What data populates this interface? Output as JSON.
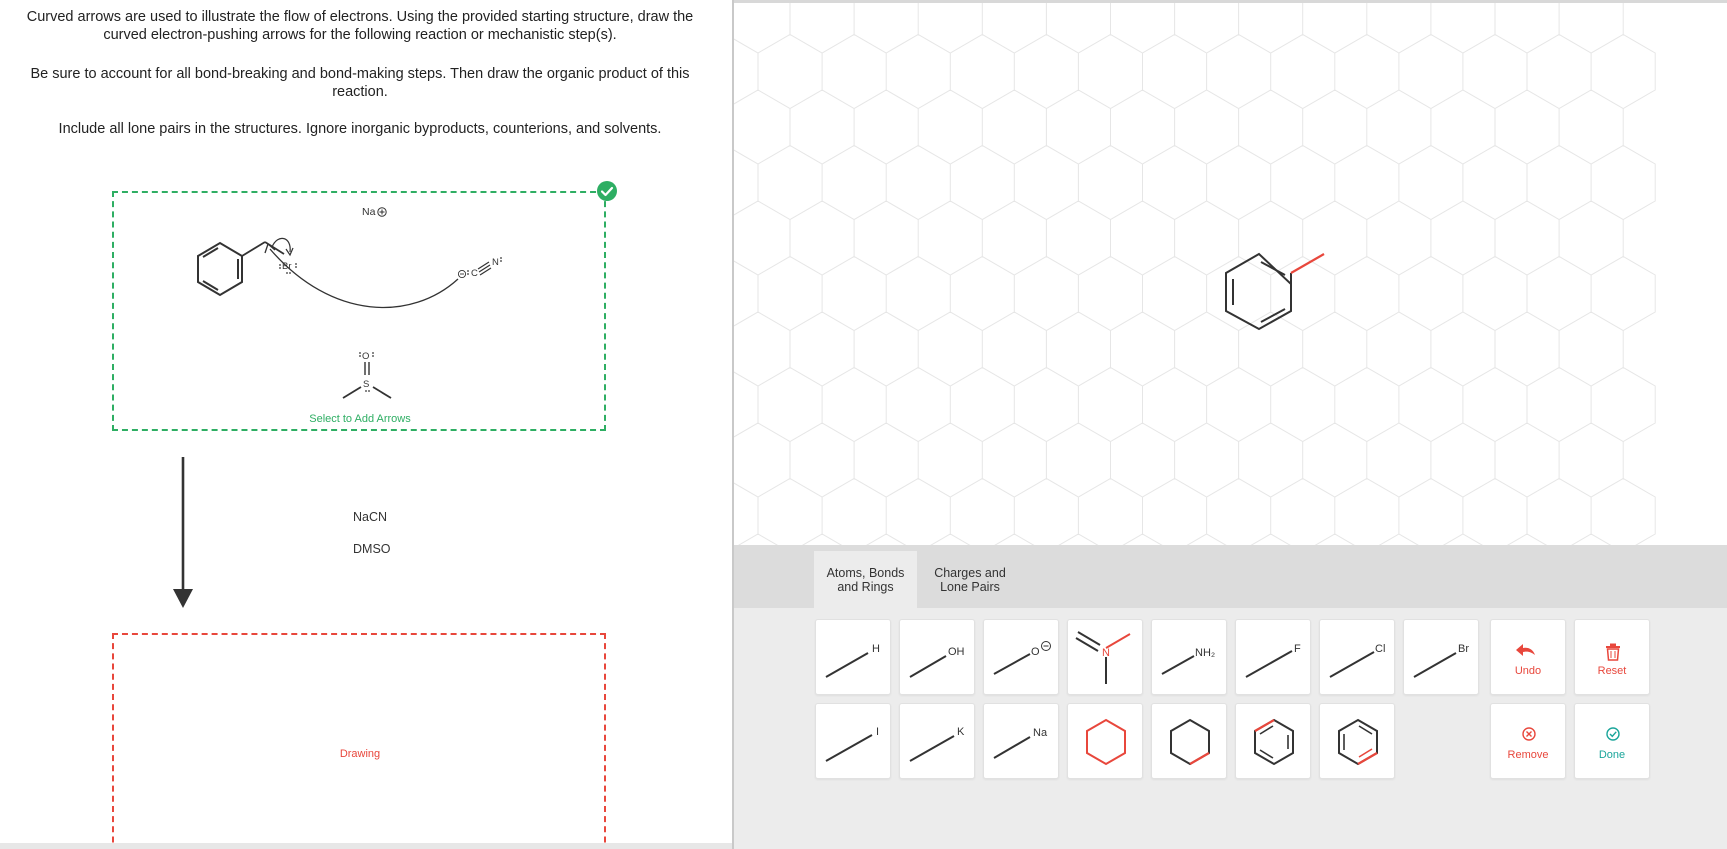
{
  "instructions": {
    "line1": "Curved arrows are used to illustrate the flow of electrons. Using the provided starting structure, draw the curved electron-pushing arrows for the following reaction or mechanistic step(s).",
    "line2": "Be sure to account for all bond-breaking and bond-making steps. Then draw the organic product of this reaction.",
    "line3": "Include all lone pairs in the structures. Ignore inorganic byproducts, counterions, and solvents."
  },
  "starting_structure": {
    "select_label": "Select to Add Arrows",
    "counterion": "Na",
    "bromine_label": "Br",
    "cyanide_c": "C",
    "cyanide_n": "N",
    "dmso_o": "O",
    "dmso_s": "S"
  },
  "reaction": {
    "reagent_1": "NaCN",
    "reagent_2": "DMSO"
  },
  "product_box": {
    "label": "Drawing"
  },
  "tabs": [
    {
      "line1": "Atoms, Bonds",
      "line2": "and Rings",
      "active": true
    },
    {
      "line1": "Charges and",
      "line2": "Lone Pairs",
      "active": false
    }
  ],
  "tools": {
    "h": "H",
    "oh": "OH",
    "o_anion": "O",
    "n": "N",
    "nh2": "NH₂",
    "f": "F",
    "cl": "Cl",
    "br": "Br",
    "i": "I",
    "k": "K",
    "na": "Na"
  },
  "actions": {
    "undo": "Undo",
    "reset": "Reset",
    "remove": "Remove",
    "done": "Done"
  },
  "colors": {
    "accent_green": "#2eae63",
    "accent_red": "#e8473c",
    "accent_teal": "#1aa59a",
    "bond": "#333333"
  }
}
